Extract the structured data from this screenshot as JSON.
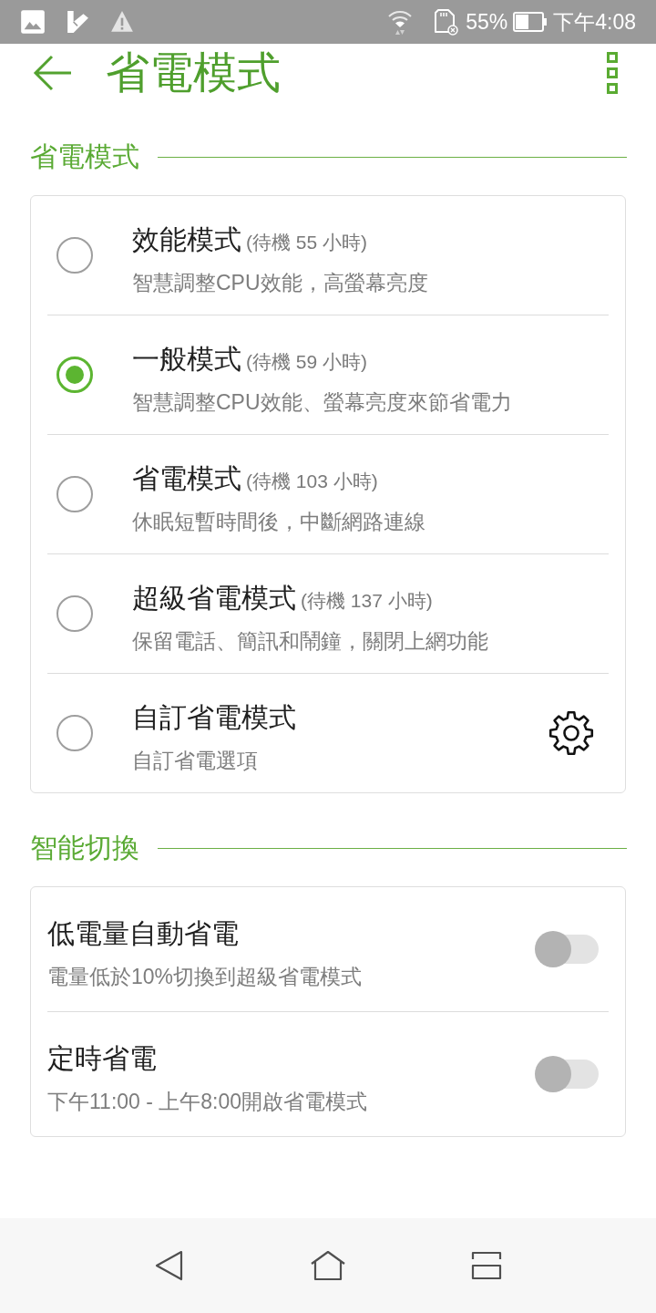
{
  "status_bar": {
    "battery": "55%",
    "time": "下午4:08"
  },
  "app_bar": {
    "title": "省電模式"
  },
  "sections": [
    {
      "title": "省電模式",
      "kind": "radio",
      "items": [
        {
          "title": "效能模式",
          "standby": "(待機 55 小時)",
          "description": "智慧調整CPU效能，高螢幕亮度",
          "selected": false,
          "settings": false
        },
        {
          "title": "一般模式",
          "standby": "(待機 59 小時)",
          "description": "智慧調整CPU效能、螢幕亮度來節省電力",
          "selected": true,
          "settings": false
        },
        {
          "title": "省電模式",
          "standby": "(待機 103 小時)",
          "description": "休眠短暫時間後，中斷網路連線",
          "selected": false,
          "settings": false
        },
        {
          "title": "超級省電模式",
          "standby": "(待機 137 小時)",
          "description": "保留電話、簡訊和鬧鐘，關閉上網功能",
          "selected": false,
          "settings": false
        },
        {
          "title": "自訂省電模式",
          "description": "自訂省電選項",
          "selected": false,
          "settings": true
        }
      ]
    },
    {
      "title": "智能切換",
      "kind": "switch",
      "items": [
        {
          "title": "低電量自動省電",
          "description": "電量低於10%切換到超級省電模式",
          "on": false
        },
        {
          "title": "定時省電",
          "description": "下午11:00 - 上午8:00開啟省電模式",
          "on": false
        }
      ]
    }
  ]
}
